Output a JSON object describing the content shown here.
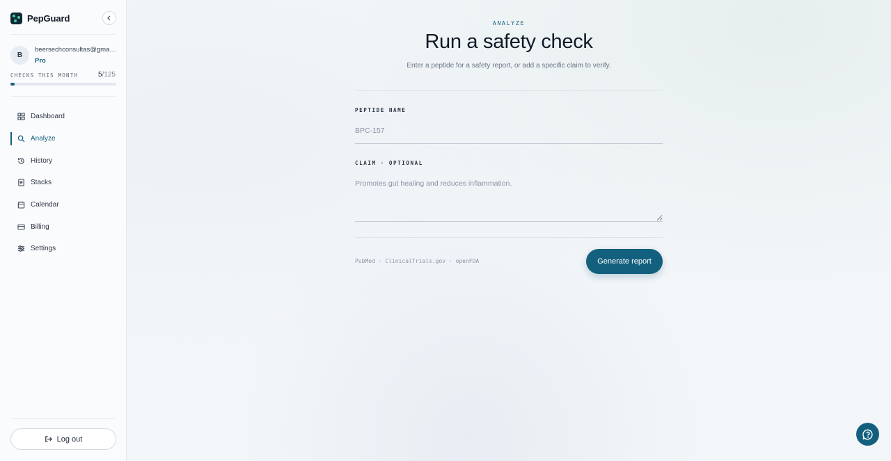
{
  "brand": {
    "name": "PepGuard"
  },
  "account": {
    "initial": "B",
    "email": "beersechconsultas@gmail.com",
    "plan": "Pro"
  },
  "usage": {
    "label": "CHECKS THIS MONTH",
    "used": "5",
    "limit": "/125",
    "fraction": 0.04
  },
  "nav": {
    "items": [
      {
        "label": "Dashboard",
        "icon": "grid-icon"
      },
      {
        "label": "Analyze",
        "icon": "search-icon",
        "active": true
      },
      {
        "label": "History",
        "icon": "history-icon"
      },
      {
        "label": "Stacks",
        "icon": "document-icon"
      },
      {
        "label": "Calendar",
        "icon": "calendar-icon"
      },
      {
        "label": "Billing",
        "icon": "card-icon"
      },
      {
        "label": "Settings",
        "icon": "sliders-icon"
      }
    ]
  },
  "logout_label": "Log out",
  "page": {
    "eyebrow": "ANALYZE",
    "title": "Run a safety check",
    "subtitle": "Enter a peptide for a safety report, or add a specific claim to verify."
  },
  "form": {
    "peptide_label": "PEPTIDE NAME",
    "peptide_placeholder": "BPC-157",
    "claim_label": "CLAIM · OPTIONAL",
    "claim_placeholder": "Promotes gut healing and reduces inflammation.",
    "sources": "PubMed · ClinicalTrials.gov · openFDA",
    "submit_label": "Generate report"
  },
  "colors": {
    "accent": "#13607e",
    "brand_dot": "#3ad1a5"
  }
}
